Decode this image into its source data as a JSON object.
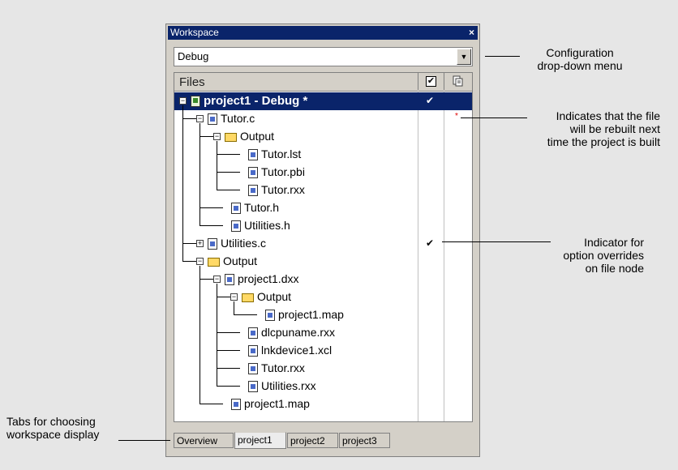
{
  "window": {
    "title": "Workspace",
    "close_glyph": "×",
    "configuration": "Debug",
    "dropdown_glyph": "▼",
    "files_header": "Files",
    "check_header_glyph": "✔",
    "tabs": [
      "Overview",
      "project1",
      "project2",
      "project3"
    ],
    "active_tab": "project1"
  },
  "tree": {
    "rows": [
      {
        "label": "project1 - Debug *",
        "icon": "project",
        "check": "✔"
      },
      {
        "label": "Tutor.c",
        "icon": "file",
        "star": "*"
      },
      {
        "label": "Output",
        "icon": "folder"
      },
      {
        "label": "Tutor.lst",
        "icon": "file"
      },
      {
        "label": "Tutor.pbi",
        "icon": "file"
      },
      {
        "label": "Tutor.rxx",
        "icon": "file"
      },
      {
        "label": "Tutor.h",
        "icon": "file"
      },
      {
        "label": "Utilities.h",
        "icon": "file"
      },
      {
        "label": "Utilities.c",
        "icon": "file",
        "check": "✔"
      },
      {
        "label": "Output",
        "icon": "folder"
      },
      {
        "label": "project1.dxx",
        "icon": "file"
      },
      {
        "label": "Output",
        "icon": "folder"
      },
      {
        "label": "project1.map",
        "icon": "file"
      },
      {
        "label": "dlcpuname.rxx",
        "icon": "file"
      },
      {
        "label": "lnkdevice1.xcl",
        "icon": "file"
      },
      {
        "label": "Tutor.rxx",
        "icon": "file"
      },
      {
        "label": "Utilities.rxx",
        "icon": "file"
      },
      {
        "label": "project1.map",
        "icon": "file"
      }
    ]
  },
  "annotations": {
    "config_line1": "Configuration",
    "config_line2": "drop-down menu",
    "rebuild_line1": "Indicates that the file",
    "rebuild_line2": "will be rebuilt next",
    "rebuild_line3": "time the project is built",
    "override_line1": "Indicator for",
    "override_line2": "option overrides",
    "override_line3": "on file node",
    "tabs_line1": "Tabs for choosing",
    "tabs_line2": "workspace display"
  },
  "colors": {
    "selection": "#0a246a",
    "window_face": "#d4d0c8",
    "background": "#e6e6e6"
  }
}
